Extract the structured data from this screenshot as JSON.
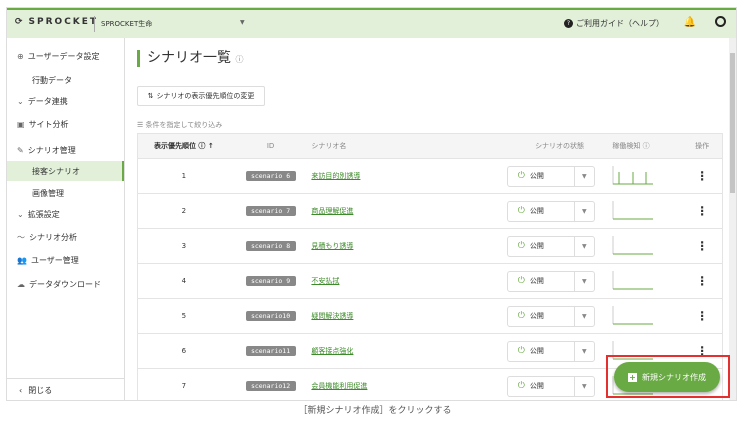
{
  "header": {
    "logo": "SPROCKET",
    "company": "SPROCKET生命",
    "help": "ご利用ガイド（ヘルプ）"
  },
  "sidebar": {
    "items": [
      {
        "label": "ユーザーデータ設定",
        "icon": "search-user-icon"
      },
      {
        "label": "行動データ"
      },
      {
        "label": "データ連携",
        "icon": "chevron-down-icon"
      },
      {
        "label": "サイト分析",
        "icon": "chart-icon"
      },
      {
        "label": "シナリオ管理",
        "icon": "pencil-icon"
      },
      {
        "label": "接客シナリオ",
        "active": true
      },
      {
        "label": "画像管理"
      },
      {
        "label": "拡張設定",
        "icon": "chevron-down-icon"
      },
      {
        "label": "シナリオ分析",
        "icon": "trend-icon"
      },
      {
        "label": "ユーザー管理",
        "icon": "users-icon"
      },
      {
        "label": "データダウンロード",
        "icon": "cloud-icon"
      }
    ],
    "close": "閉じる"
  },
  "main": {
    "title": "シナリオ一覧",
    "priority_button": "シナリオの表示優先順位の変更",
    "filter": "条件を指定して絞り込み",
    "columns": [
      "表示優先順位",
      "ID",
      "シナリオ名",
      "シナリオの状態",
      "稼働検知",
      "操作"
    ],
    "rows": [
      {
        "priority": "1",
        "id": "scenario 6",
        "name": "来訪目的別誘導",
        "status": "公開"
      },
      {
        "priority": "2",
        "id": "scenario 7",
        "name": "商品理解促進",
        "status": "公開"
      },
      {
        "priority": "3",
        "id": "scenario 8",
        "name": "見積もり誘導",
        "status": "公開"
      },
      {
        "priority": "4",
        "id": "scenario 9",
        "name": "不安払拭",
        "status": "公開"
      },
      {
        "priority": "5",
        "id": "scenario10",
        "name": "疑問解決誘導",
        "status": "公開"
      },
      {
        "priority": "6",
        "id": "scenario11",
        "name": "顧客接点強化",
        "status": "公開"
      },
      {
        "priority": "7",
        "id": "scenario12",
        "name": "会員機能利用促進",
        "status": "公開"
      }
    ],
    "new_button": "新規シナリオ作成"
  },
  "caption": "［新規シナリオ作成］をクリックする",
  "colors": {
    "accent": "#6aaa45",
    "highlight": "#e53030"
  }
}
